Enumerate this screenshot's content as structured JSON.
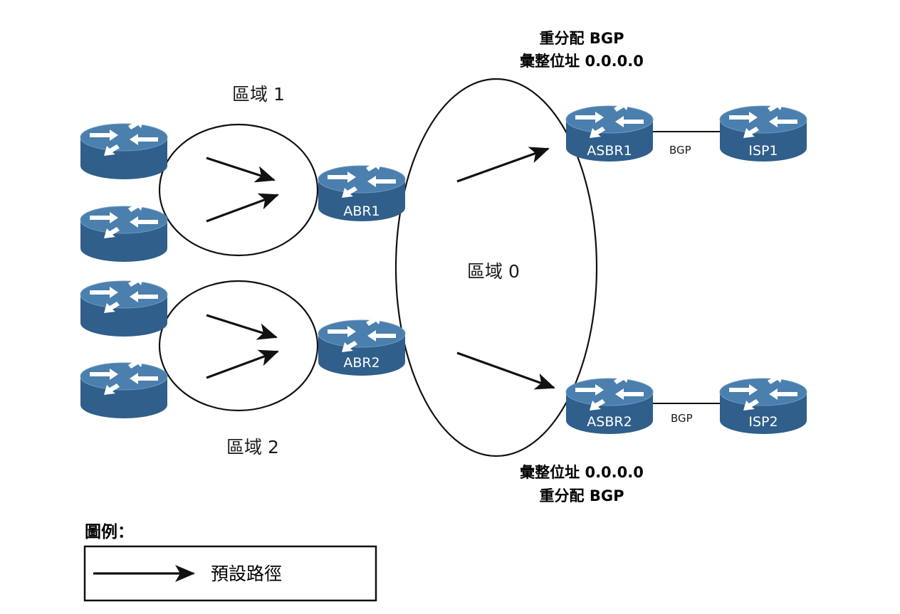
{
  "areas": {
    "area1": "區域 1",
    "area2": "區域 2",
    "area0": "區域 0"
  },
  "routers": {
    "abr1": "ABR1",
    "abr2": "ABR2",
    "asbr1": "ASBR1",
    "asbr2": "ASBR2",
    "isp1": "ISP1",
    "isp2": "ISP2"
  },
  "links": {
    "bgp_top": "BGP",
    "bgp_bottom": "BGP"
  },
  "notes": {
    "top_line1": "重分配 BGP",
    "top_line2": "彙整位址 0.0.0.0",
    "bottom_line1": "彙整位址 0.0.0.0",
    "bottom_line2": "重分配 BGP"
  },
  "legend": {
    "title": "圖例：",
    "default_route": "預設路徑"
  },
  "colors": {
    "router_body": "#2f5f8a",
    "router_top": "#4a7fae",
    "router_highlight": "#ffffff",
    "line": "#111111"
  }
}
